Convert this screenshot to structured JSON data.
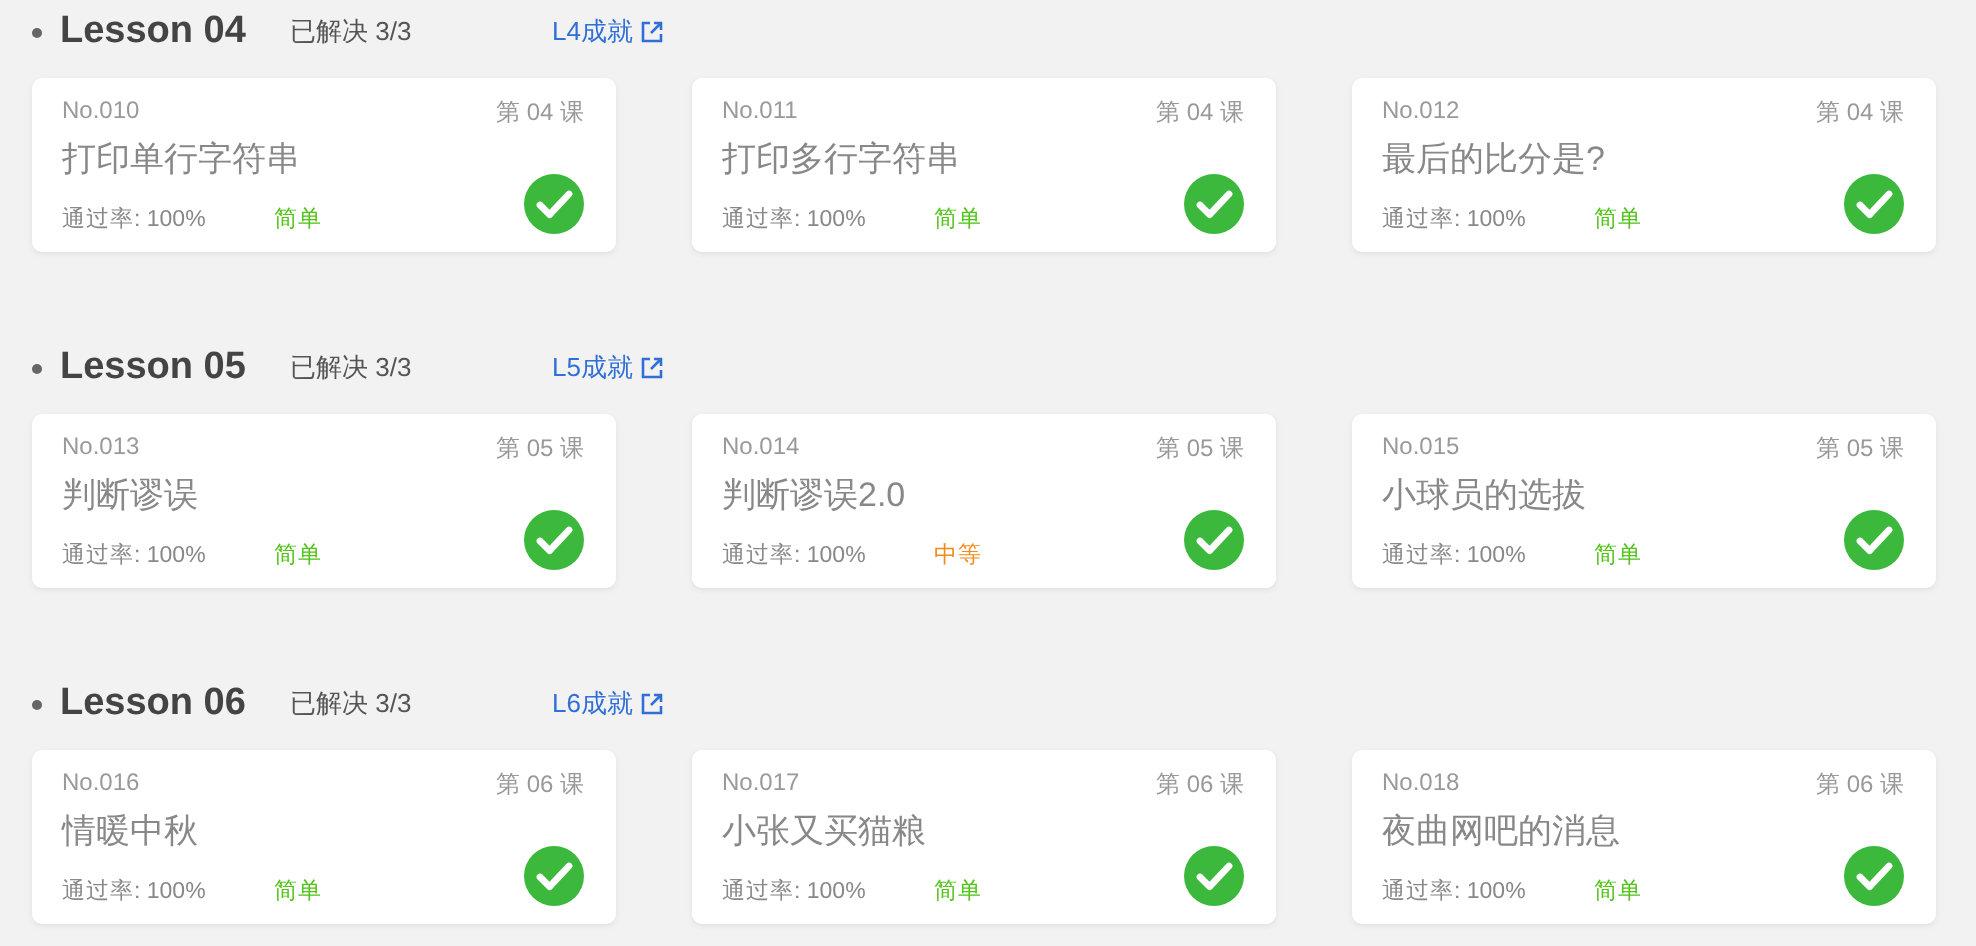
{
  "lessons": [
    {
      "title": "Lesson 04",
      "solved": "已解决 3/3",
      "link": "L4成就",
      "problems": [
        {
          "number": "No.010",
          "lesson": "第 04 课",
          "name": "打印单行字符串",
          "pass_rate": "通过率: 100%",
          "difficulty": "简单",
          "color": "#52c41a",
          "solved": true
        },
        {
          "number": "No.011",
          "lesson": "第 04 课",
          "name": "打印多行字符串",
          "pass_rate": "通过率: 100%",
          "difficulty": "简单",
          "color": "#52c41a",
          "solved": true
        },
        {
          "number": "No.012",
          "lesson": "第 04 课",
          "name": "最后的比分是?",
          "pass_rate": "通过率: 100%",
          "difficulty": "简单",
          "color": "#52c41a",
          "solved": true
        }
      ]
    },
    {
      "title": "Lesson 05",
      "solved": "已解决 3/3",
      "link": "L5成就",
      "problems": [
        {
          "number": "No.013",
          "lesson": "第 05 课",
          "name": "判断谬误",
          "pass_rate": "通过率: 100%",
          "difficulty": "简单",
          "color": "#52c41a",
          "solved": true
        },
        {
          "number": "No.014",
          "lesson": "第 05 课",
          "name": "判断谬误2.0",
          "pass_rate": "通过率: 100%",
          "difficulty": "中等",
          "color": "#f08c1e",
          "solved": true
        },
        {
          "number": "No.015",
          "lesson": "第 05 课",
          "name": "小球员的选拔",
          "pass_rate": "通过率: 100%",
          "difficulty": "简单",
          "color": "#52c41a",
          "solved": true
        }
      ]
    },
    {
      "title": "Lesson 06",
      "solved": "已解决 3/3",
      "link": "L6成就",
      "problems": [
        {
          "number": "No.016",
          "lesson": "第 06 课",
          "name": "情暖中秋",
          "pass_rate": "通过率: 100%",
          "difficulty": "简单",
          "color": "#52c41a",
          "solved": true
        },
        {
          "number": "No.017",
          "lesson": "第 06 课",
          "name": "小张又买猫粮",
          "pass_rate": "通过率: 100%",
          "difficulty": "简单",
          "color": "#52c41a",
          "solved": true
        },
        {
          "number": "No.018",
          "lesson": "第 06 课",
          "name": "夜曲网吧的消息",
          "pass_rate": "通过率: 100%",
          "difficulty": "简单",
          "color": "#52c41a",
          "solved": true
        }
      ]
    }
  ]
}
